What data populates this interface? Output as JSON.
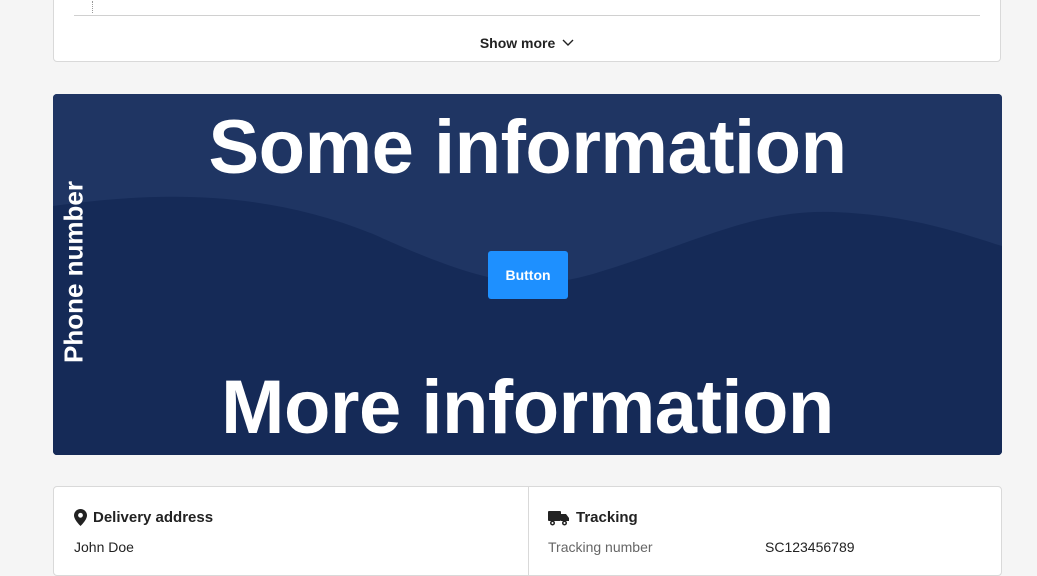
{
  "top_card": {
    "show_more_label": "Show more"
  },
  "banner": {
    "headline_top": "Some information",
    "headline_bottom": "More information",
    "side_label": "Phone number",
    "button_label": "Button"
  },
  "delivery": {
    "title": "Delivery address",
    "name": "John Doe"
  },
  "tracking": {
    "title": "Tracking",
    "number_label": "Tracking number",
    "number_value": "SC123456789"
  },
  "colors": {
    "banner_bg": "#1f3563",
    "banner_wave": "#152a57",
    "button_bg": "#1e90ff"
  }
}
